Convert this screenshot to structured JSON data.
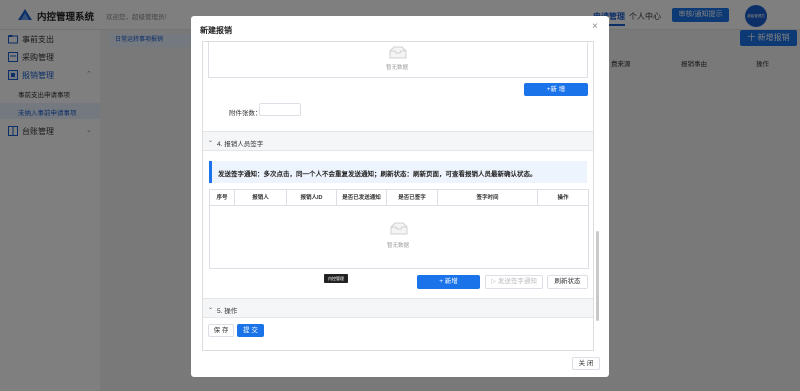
{
  "app": {
    "title": "内控管理系统",
    "welcome": "欢迎您，超级管理员!",
    "nav_active": "申请管理",
    "nav_personal": "个人中心",
    "audit_button": "审核/通知提示",
    "avatar_text": "超级管理员"
  },
  "sidebar": {
    "items": [
      {
        "label": "事前支出"
      },
      {
        "label": "采购管理"
      },
      {
        "label": "报销管理"
      },
      {
        "label": "台账管理"
      }
    ],
    "subitems": [
      {
        "label": "事前支出申请事项"
      },
      {
        "label": "未纳入事前申请事项"
      }
    ]
  },
  "main": {
    "breadcrumb_tab": "日常运转事项报销",
    "add_button": "十 新增报销",
    "columns": [
      "费来源",
      "报销事由",
      "操作"
    ]
  },
  "dialog": {
    "title": "新建报销",
    "close_icon": "×",
    "empty_text": "暂无数据",
    "top_add_button": "+新 增",
    "attachments_label": "附件张数：",
    "attachments_value": "",
    "section4_title": "4. 报销人员签字",
    "notice_text": "发送签字通知：多次点击，同一个人不会重复发送通知；刷新状态：刷新页面，可查看报销人员最新确认状态。",
    "sign_table_headers": [
      "序号",
      "报销人",
      "报销人ID",
      "是否已发送通知",
      "是否已签字",
      "签字时间",
      "操作"
    ],
    "sign_empty_text": "暂无数据",
    "add_button": "+ 新增",
    "send_notice_button": "发送签字通知",
    "refresh_button": "刷新状态",
    "tooltip": "内控管理",
    "section5_title": "5. 操作",
    "save_button": "保 存",
    "submit_button": "提 交",
    "footer_close_button": "关 闭"
  },
  "colors": {
    "primary": "#1a73e8",
    "mask": "rgba(0,0,0,0.5)",
    "notice_bg": "#eef4fd"
  }
}
